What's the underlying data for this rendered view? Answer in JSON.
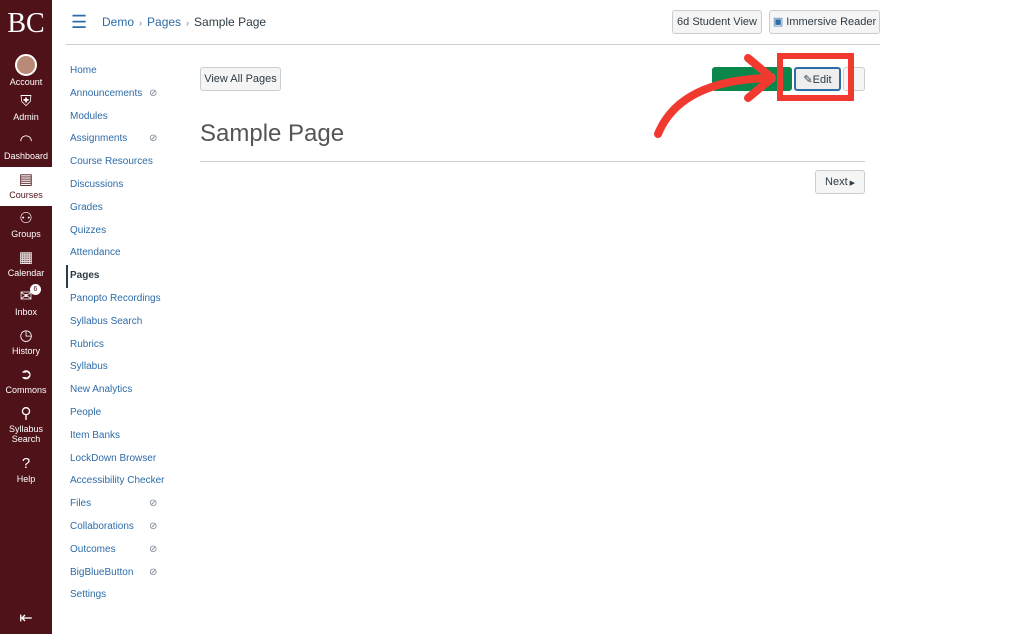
{
  "global_nav": {
    "logo": "BC",
    "items": [
      {
        "label": "Account",
        "icon": "avatar"
      },
      {
        "label": "Admin",
        "icon": "shield-icon"
      },
      {
        "label": "Dashboard",
        "icon": "speedometer-icon"
      },
      {
        "label": "Courses",
        "icon": "book-icon",
        "active": true
      },
      {
        "label": "Groups",
        "icon": "groups-icon"
      },
      {
        "label": "Calendar",
        "icon": "calendar-icon"
      },
      {
        "label": "Inbox",
        "icon": "inbox-icon",
        "badge": "6"
      },
      {
        "label": "History",
        "icon": "clock-icon"
      },
      {
        "label": "Commons",
        "icon": "commons-icon"
      },
      {
        "label": "Syllabus Search",
        "icon": "search-icon"
      },
      {
        "label": "Help",
        "icon": "help-icon"
      }
    ]
  },
  "breadcrumb": [
    "Demo",
    "Pages",
    "Sample Page"
  ],
  "header": {
    "student_view": "Student View",
    "immersive_reader": "Immersive Reader"
  },
  "course_nav": [
    {
      "label": "Home"
    },
    {
      "label": "Announcements",
      "hidden": true
    },
    {
      "label": "Modules"
    },
    {
      "label": "Assignments",
      "hidden": true
    },
    {
      "label": "Course Resources"
    },
    {
      "label": "Discussions"
    },
    {
      "label": "Grades"
    },
    {
      "label": "Quizzes"
    },
    {
      "label": "Attendance"
    },
    {
      "label": "Pages",
      "active": true
    },
    {
      "label": "Panopto Recordings"
    },
    {
      "label": "Syllabus Search"
    },
    {
      "label": "Rubrics"
    },
    {
      "label": "Syllabus"
    },
    {
      "label": "New Analytics"
    },
    {
      "label": "People"
    },
    {
      "label": "Item Banks"
    },
    {
      "label": "LockDown Browser"
    },
    {
      "label": "Accessibility Checker"
    },
    {
      "label": "Files",
      "hidden": true
    },
    {
      "label": "Collaborations",
      "hidden": true
    },
    {
      "label": "Outcomes",
      "hidden": true
    },
    {
      "label": "BigBlueButton",
      "hidden": true
    },
    {
      "label": "Settings"
    }
  ],
  "page": {
    "view_all": "View All Pages",
    "published_visible": "d",
    "edit": "Edit",
    "title": "Sample Page",
    "next": "Next"
  },
  "colors": {
    "nav_bg": "#4e1218",
    "link": "#2d6ca8",
    "published": "#0b874b",
    "annotation": "#f03a30"
  }
}
